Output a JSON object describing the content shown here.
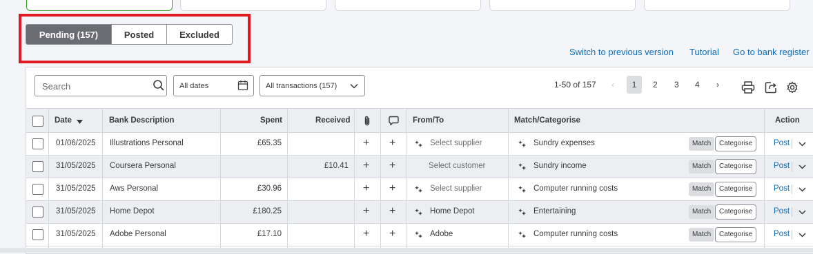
{
  "tabs": [
    {
      "label": "Pending (157)",
      "active": true
    },
    {
      "label": "Posted",
      "active": false
    },
    {
      "label": "Excluded",
      "active": false
    }
  ],
  "links": {
    "switch_previous": "Switch to previous version",
    "tutorial": "Tutorial",
    "bank_register": "Go to bank register"
  },
  "toolbar": {
    "search_placeholder": "Search",
    "date_filter": "All dates",
    "transactions_filter": "All transactions (157)",
    "range": "1-50 of 157",
    "pages": [
      "1",
      "2",
      "3",
      "4"
    ],
    "current_page": "1"
  },
  "columns": {
    "date": "Date",
    "description": "Bank Description",
    "spent": "Spent",
    "received": "Received",
    "from_to": "From/To",
    "match": "Match/Categorise",
    "action": "Action"
  },
  "buttons": {
    "match": "Match",
    "categorise": "Categorise",
    "post": "Post"
  },
  "rows": [
    {
      "date": "01/06/2025",
      "description": "Illustrations Personal",
      "spent": "£65.35",
      "received": "",
      "from_to": "Select supplier",
      "from_to_placeholder": true,
      "category": "Sundry expenses"
    },
    {
      "date": "31/05/2025",
      "description": "Coursera Personal",
      "spent": "",
      "received": "£10.41",
      "from_to": "Select customer",
      "from_to_placeholder": true,
      "category": "Sundry income"
    },
    {
      "date": "31/05/2025",
      "description": "Aws Personal",
      "spent": "£30.96",
      "received": "",
      "from_to": "Select supplier",
      "from_to_placeholder": true,
      "category": "Computer running costs"
    },
    {
      "date": "31/05/2025",
      "description": "Home Depot",
      "spent": "£180.25",
      "received": "",
      "from_to": "Home Depot",
      "from_to_placeholder": false,
      "category": "Entertaining"
    },
    {
      "date": "31/05/2025",
      "description": "Adobe Personal",
      "spent": "£17.10",
      "received": "",
      "from_to": "Adobe",
      "from_to_placeholder": false,
      "category": "Computer running costs"
    }
  ],
  "colors": {
    "highlight": "#e01a22",
    "link": "#0d6ebd",
    "active_tab": "#6b6c72"
  }
}
